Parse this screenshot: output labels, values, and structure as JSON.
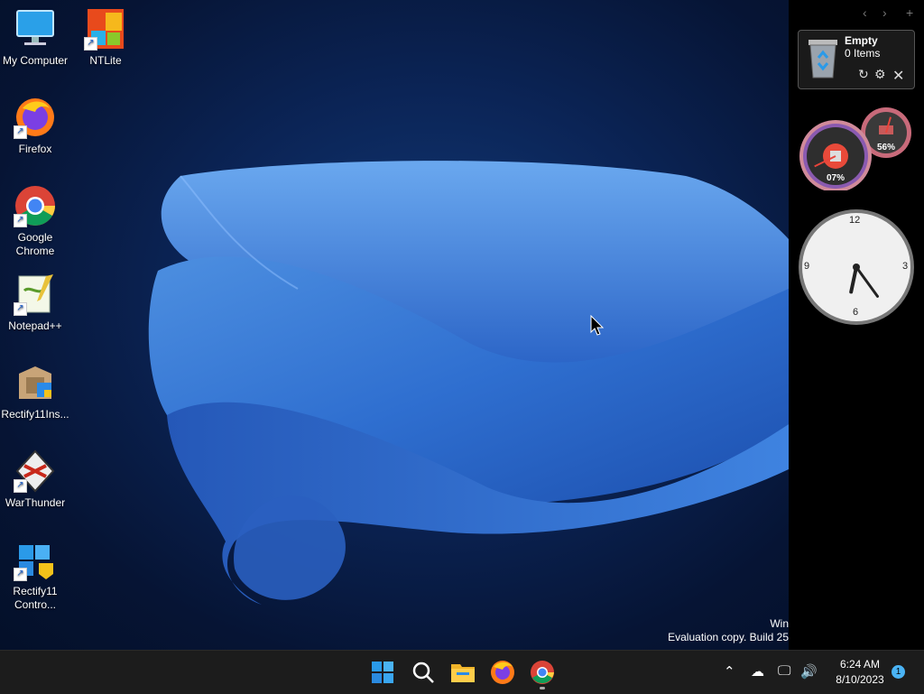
{
  "desktop": {
    "icons": [
      {
        "label": "My Computer"
      },
      {
        "label": "NTLite"
      },
      {
        "label": "Firefox"
      },
      {
        "label": "Google Chrome"
      },
      {
        "label": "Notepad++"
      },
      {
        "label": "Rectify11Ins..."
      },
      {
        "label": "WarThunder"
      },
      {
        "label": "Rectify11 Contro..."
      }
    ],
    "watermark": {
      "line1": "Win",
      "line2": "Evaluation copy. Build 25"
    }
  },
  "sidebar": {
    "nav": {
      "back": "‹",
      "forward": "›",
      "add": "+"
    },
    "recycle_bin": {
      "status": "Empty",
      "count": "0 Items",
      "refresh_icon": "↻",
      "settings_icon": "⚙",
      "close_icon": "✕"
    },
    "cpu_meter": {
      "cpu_percent": "07%",
      "memory_percent": "56%",
      "cpu_value": 0.07,
      "memory_value": 0.56
    },
    "analog_clock": {
      "n12": "12",
      "n3": "3",
      "n6": "6",
      "n9": "9",
      "hour": 6,
      "minute": 24
    }
  },
  "taskbar": {
    "apps": [
      "start",
      "search",
      "file-explorer",
      "firefox",
      "chrome"
    ],
    "tray": {
      "chevron": "⌃",
      "cloud": "☁",
      "network": "🖵",
      "volume": "🔊"
    },
    "time": "6:24 AM",
    "date": "8/10/2023",
    "notifications": "1"
  },
  "colors": {
    "accent": "#0078d4",
    "sidebar_bg": "#000000",
    "taskbar_bg": "#1c1c1c"
  }
}
